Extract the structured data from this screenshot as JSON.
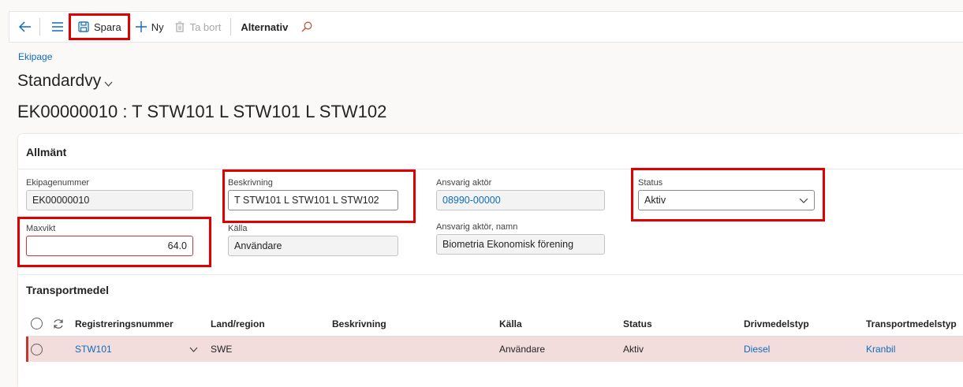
{
  "toolbar": {
    "back_icon": "back-arrow-icon",
    "menu_icon": "hamburger-icon",
    "save_label": "Spara",
    "new_label": "Ny",
    "delete_label": "Ta bort",
    "options_label": "Alternativ",
    "search_icon": "search-icon"
  },
  "breadcrumb": "Ekipage",
  "view_title": "Standardvy",
  "record_title": "EK00000010 : T STW101 L STW101 L STW102",
  "general": {
    "header": "Allmänt",
    "fields": {
      "ekipagenummer": {
        "label": "Ekipagenummer",
        "value": "EK00000010"
      },
      "beskrivning": {
        "label": "Beskrivning",
        "value": "T STW101 L STW101 L STW102"
      },
      "ansvarig_aktor": {
        "label": "Ansvarig aktör",
        "value": "08990-00000"
      },
      "status": {
        "label": "Status",
        "value": "Aktiv"
      },
      "maxvikt": {
        "label": "Maxvikt",
        "value": "64.0"
      },
      "kalla": {
        "label": "Källa",
        "value": "Användare"
      },
      "ansvarig_aktor_namn": {
        "label": "Ansvarig aktör, namn",
        "value": "Biometria Ekonomisk förening"
      }
    }
  },
  "transport": {
    "header": "Transportmedel",
    "columns": [
      "Registreringsnummer",
      "Land/region",
      "Beskrivning",
      "Källa",
      "Status",
      "Drivmedelstyp",
      "Transportmedelstyp"
    ],
    "rows": [
      {
        "reg": "STW101",
        "land": "SWE",
        "beskrivning": "",
        "kalla": "Användare",
        "status": "Aktiv",
        "drivmedel": "Diesel",
        "typ": "Kranbil"
      }
    ]
  },
  "colors": {
    "accent": "#0f6cbd",
    "highlight": "#e00000",
    "selected_row": "#f2dcdc"
  }
}
